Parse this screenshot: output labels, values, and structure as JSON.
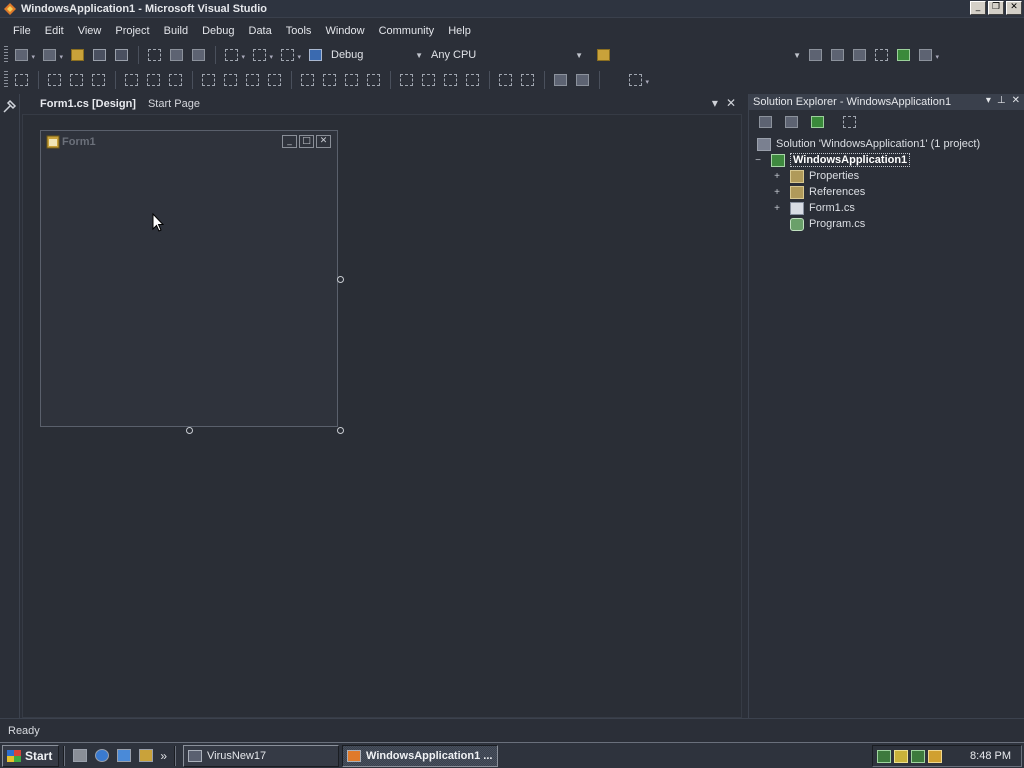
{
  "window": {
    "title": "WindowsApplication1 - Microsoft Visual Studio",
    "controls": {
      "minimize": "_",
      "maximize": "❐",
      "close": "✕"
    }
  },
  "menu": [
    "File",
    "Edit",
    "View",
    "Project",
    "Build",
    "Debug",
    "Data",
    "Tools",
    "Window",
    "Community",
    "Help"
  ],
  "toolbar": {
    "configuration": "Debug",
    "platform": "Any CPU"
  },
  "documents": {
    "tabs": [
      "Form1.cs [Design]",
      "Start Page"
    ],
    "active_tab": "Form1.cs [Design]",
    "close_glyph": "✕",
    "menu_glyph": "▾"
  },
  "designer": {
    "form_title": "Form1",
    "form_buttons": {
      "minimize": "_",
      "maximize": "□",
      "close": "✕"
    }
  },
  "solution_explorer": {
    "title": "Solution Explorer - WindowsApplication1",
    "title_controls": [
      "▾",
      "⊥",
      "✕"
    ],
    "tree": {
      "solution": "Solution 'WindowsApplication1' (1 project)",
      "project": "WindowsApplication1",
      "items": [
        {
          "label": "Properties",
          "expander": "+",
          "icon": "folder-icon"
        },
        {
          "label": "References",
          "expander": "+",
          "icon": "folder-icon"
        },
        {
          "label": "Form1.cs",
          "expander": "+",
          "icon": "form-icon"
        },
        {
          "label": "Program.cs",
          "expander": "",
          "icon": "cs-file-icon"
        }
      ],
      "project_expander": "−"
    }
  },
  "status": {
    "text": "Ready"
  },
  "taskbar": {
    "start_label": "Start",
    "quicklaunch_more": "»",
    "tasks": [
      {
        "label": "VirusNew17",
        "active": false
      },
      {
        "label": "WindowsApplication1 ...",
        "active": true
      }
    ],
    "clock": "8:48 PM"
  }
}
